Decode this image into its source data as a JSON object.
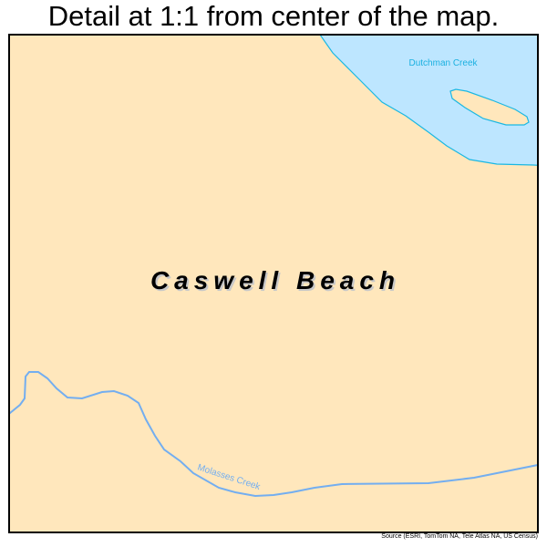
{
  "title": "Detail at 1:1 from center of the map.",
  "map": {
    "place_name": "Caswell Beach",
    "water_features": [
      {
        "name": "Dutchman Creek",
        "type": "water-body"
      },
      {
        "name": "Molasses Creek",
        "type": "stream"
      }
    ],
    "colors": {
      "land": "#ffe7bc",
      "water_fill": "#bde6ff",
      "water_outline": "#1ab8e3",
      "stream": "#73aef0",
      "water_label": "#1ab0e0",
      "stream_label": "#73aef0"
    }
  },
  "source": "Source (ESRI, TomTom NA, Tele Atlas NA, US Census)"
}
